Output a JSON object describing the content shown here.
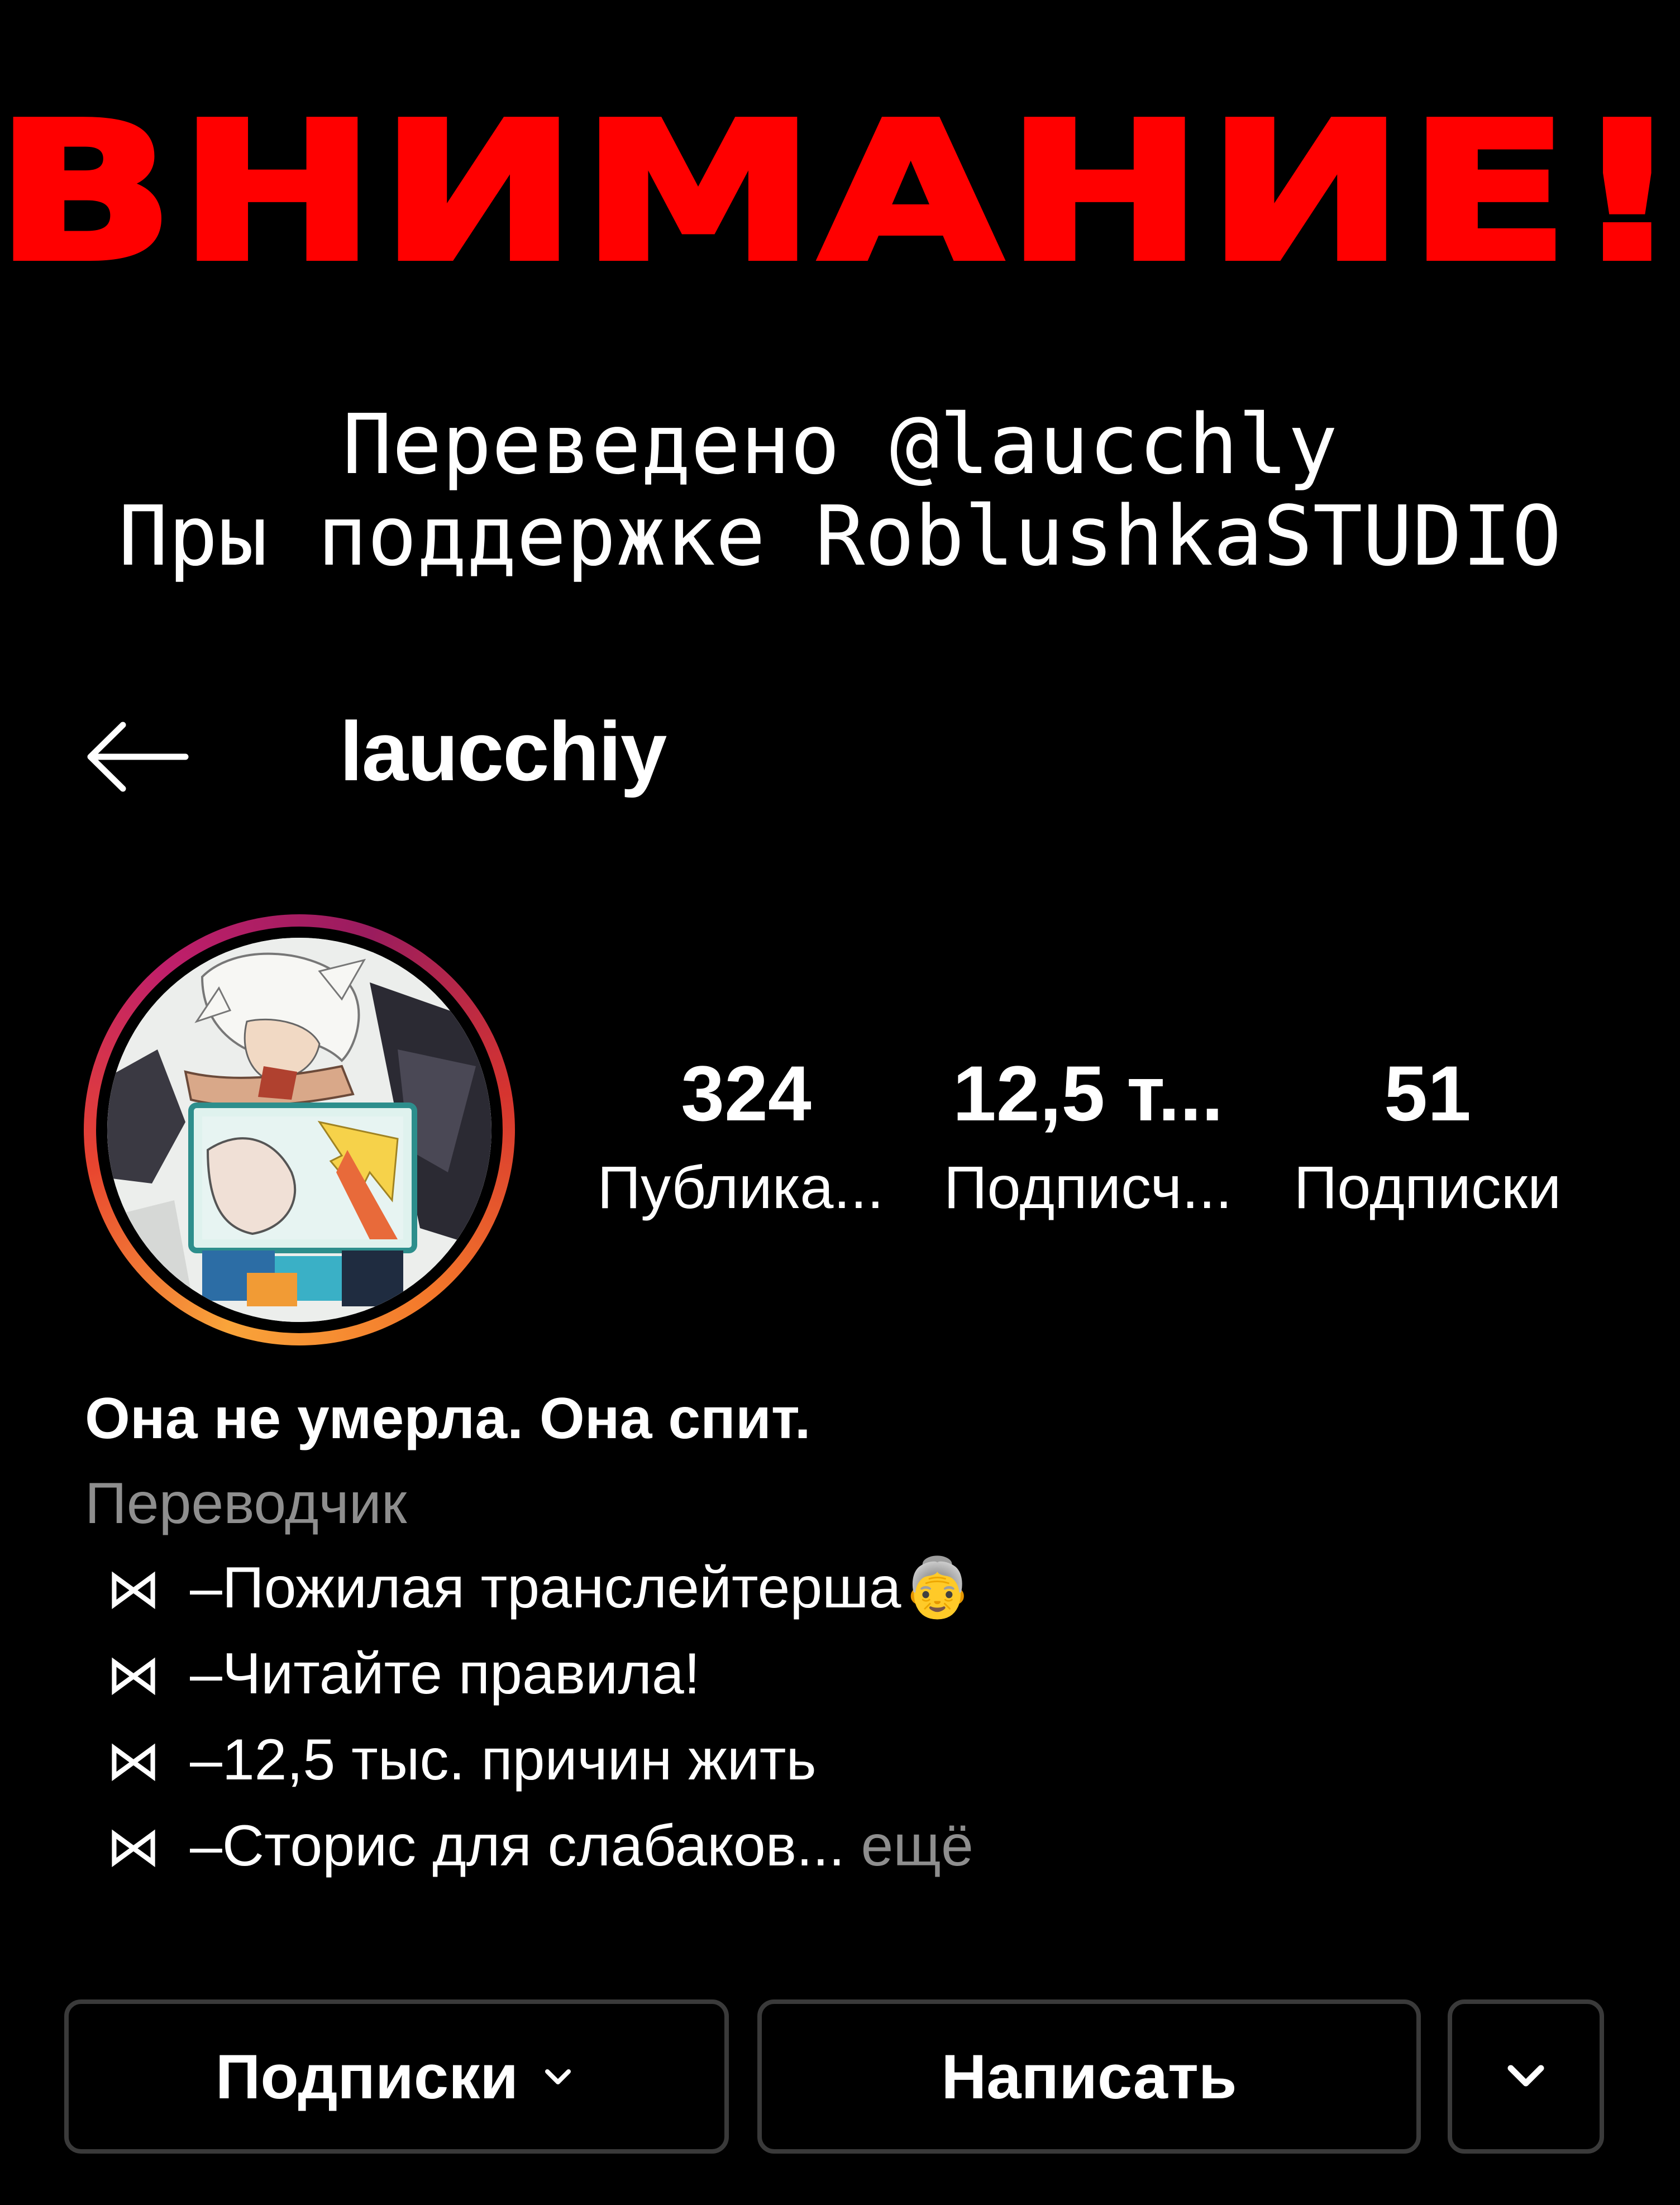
{
  "banner": {
    "title": "ВНИМАНИЕ!",
    "credit_line1": "Переведено @laucchly",
    "credit_line2": "Пры поддержке RoblushkaSTUDIO",
    "title_color": "#ff0000"
  },
  "header": {
    "back_icon": "arrow-left-icon",
    "username": "laucchiy"
  },
  "stats": [
    {
      "value": "324",
      "label": "Публика..."
    },
    {
      "value": "12,5 т...",
      "label": "Подписч..."
    },
    {
      "value": "51",
      "label": "Подписки"
    }
  ],
  "bio": {
    "name": "Она не умерла. Она спит.",
    "category": "Переводчик",
    "lines": [
      {
        "mark": "⋈",
        "text": "–Пожилая транслейтерша👵"
      },
      {
        "mark": "⋈",
        "text": "–Читайте правила!"
      },
      {
        "mark": "⋈",
        "text": "–12,5 тыс. причин жить"
      },
      {
        "mark": "⋈",
        "text": "–Сторис для слабаков...",
        "more": " ещё"
      }
    ]
  },
  "buttons": {
    "follow_label": "Подписки",
    "follow_icon": "chevron-down-icon",
    "message_label": "Написать",
    "more_icon": "chevron-down-icon"
  },
  "colors": {
    "background": "#000000",
    "secondary_text": "#8e8e8e",
    "button_border": "#3a3a3a"
  }
}
